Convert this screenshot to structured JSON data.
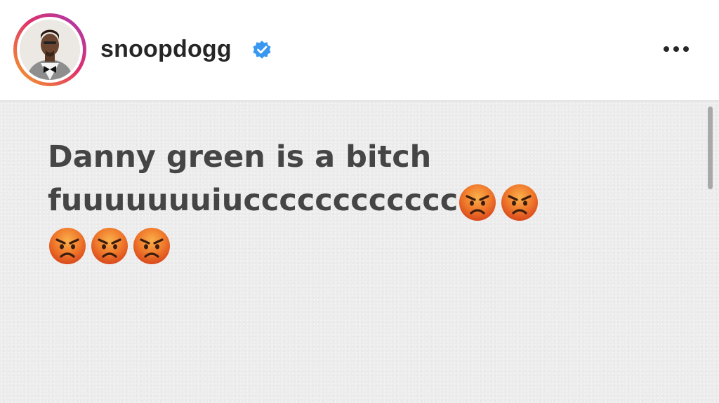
{
  "post": {
    "username": "snoopdogg",
    "verified": true,
    "avatar_icon": "profile-photo",
    "more_icon": "ellipsis-horizontal-icon"
  },
  "note": {
    "line1": "Danny green is a bitch",
    "line2": "fuuuuuuuiucccccccccccc",
    "emoji_name": "angry-face",
    "emoji_count": 5
  },
  "colors": {
    "username": "#262626",
    "verified_badge": "#3897f0",
    "note_text": "#454545",
    "note_background": "#ececec"
  }
}
